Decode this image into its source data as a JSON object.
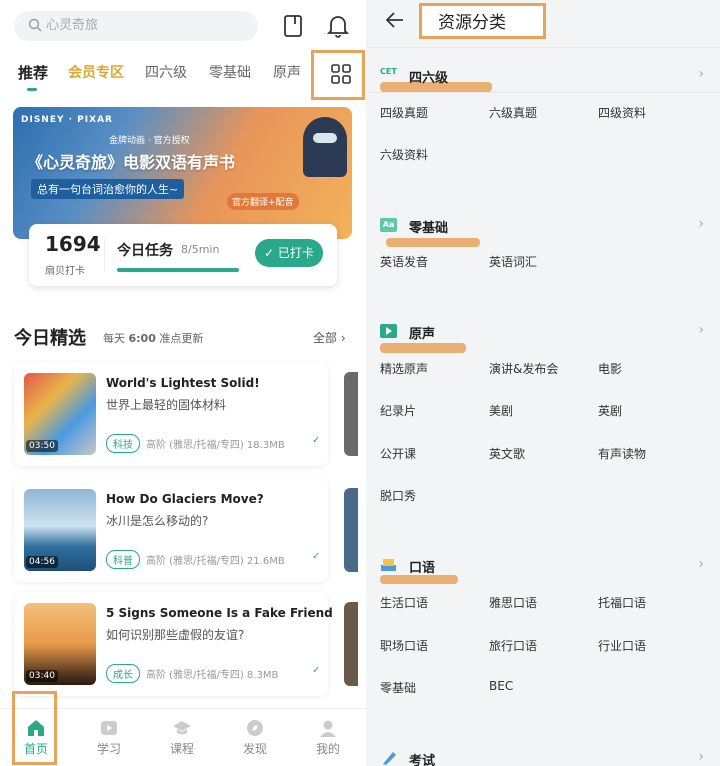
{
  "left": {
    "search": {
      "placeholder": "心灵奇旅"
    },
    "tabs": [
      "推荐",
      "会员专区",
      "四六级",
      "零基础",
      "原声"
    ],
    "banner": {
      "brand": "DISNEY · PIXAR",
      "badge": "金牌动画 · 官方授权",
      "title": "《心灵奇旅》电影双语有声书",
      "subtitle": "总有一句台词治愈你的人生~",
      "extra": "官方翻译+配音"
    },
    "checkin": {
      "count": "1694",
      "count_label": "扇贝打卡",
      "task_label": "今日任务",
      "task_progress": "8/5min",
      "button": "已打卡"
    },
    "today": {
      "title": "今日精选",
      "update_prefix": "每天",
      "update_time": "6:00",
      "update_suffix": "准点更新",
      "all_label": "全部"
    },
    "items": [
      {
        "title": "World's Lightest Solid!",
        "subtitle": "世界上最轻的固体材料",
        "duration": "03:50",
        "tag": "科技",
        "meta": "高阶 (雅思/托福/专四)",
        "size": "18.3MB"
      },
      {
        "title": "How Do Glaciers Move?",
        "subtitle": "冰川是怎么移动的?",
        "duration": "04:56",
        "tag": "科普",
        "meta": "高阶 (雅思/托福/专四)",
        "size": "21.6MB"
      },
      {
        "title": "5 Signs Someone Is a Fake Friend",
        "subtitle": "如何识别那些虚假的友谊?",
        "duration": "03:40",
        "tag": "成长",
        "meta": "高阶 (雅思/托福/专四)",
        "size": "8.3MB"
      }
    ],
    "nav": [
      "首页",
      "学习",
      "课程",
      "发现",
      "我的"
    ]
  },
  "right": {
    "title": "资源分类",
    "sections": [
      {
        "icon_text": "CET",
        "name": "四六级",
        "items": [
          "四级真题",
          "六级真题",
          "四级资料",
          "六级资料"
        ]
      },
      {
        "icon_text": "Aa",
        "name": "零基础",
        "items": [
          "英语发音",
          "英语词汇"
        ]
      },
      {
        "icon_text": "",
        "name": "原声",
        "items": [
          "精选原声",
          "演讲&发布会",
          "电影",
          "纪录片",
          "美剧",
          "英剧",
          "公开课",
          "英文歌",
          "有声读物",
          "脱口秀"
        ]
      },
      {
        "icon_text": "",
        "name": "口语",
        "items": [
          "生活口语",
          "雅思口语",
          "托福口语",
          "职场口语",
          "旅行口语",
          "行业口语",
          "零基础",
          "BEC"
        ]
      },
      {
        "icon_text": "",
        "name": "考试",
        "items": []
      }
    ]
  },
  "colors": {
    "accent": "#2aa98a",
    "highlight": "#e8a25a",
    "vip": "#d9a63a"
  }
}
